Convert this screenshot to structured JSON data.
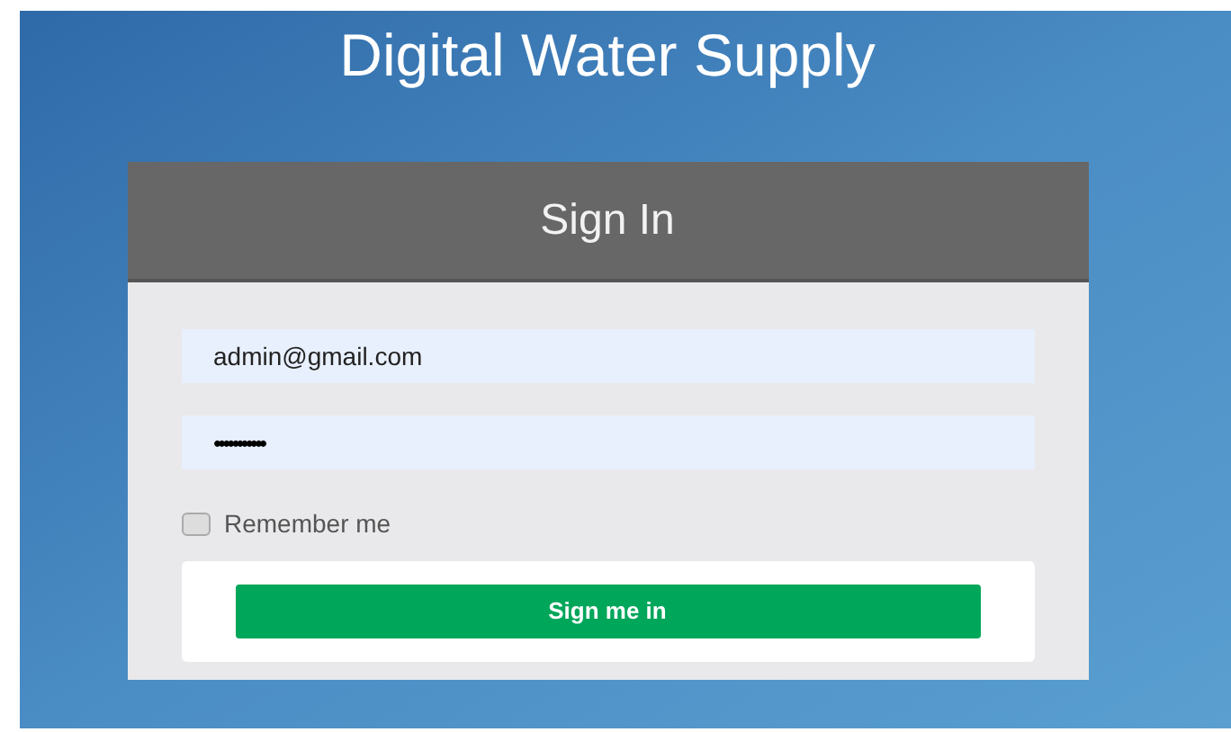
{
  "page": {
    "title": "Digital Water Supply"
  },
  "sign_in": {
    "heading": "Sign In",
    "email": {
      "value": "admin@gmail.com"
    },
    "password": {
      "value": "•••••••••••"
    },
    "remember": {
      "label": "Remember me",
      "checked": false
    },
    "submit": {
      "label": "Sign me in"
    }
  }
}
